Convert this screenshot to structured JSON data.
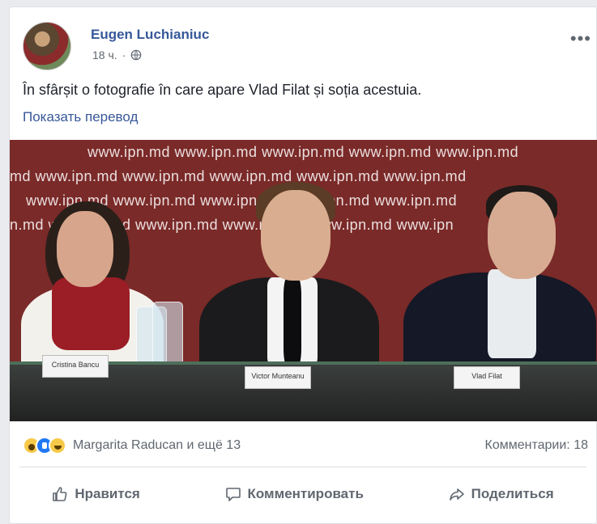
{
  "post": {
    "author": "Eugen Luchianiuc",
    "time": "18 ч.",
    "separator": "·",
    "more": "•••",
    "text": "În sfârșit o fotografie în care apare Vlad Filat și soția acestuia.",
    "translate": "Показать перевод"
  },
  "photo": {
    "backdrop": [
      "www.ipn.md   www.ipn.md   www.ipn.md   www.ipn.md   www.ipn.md",
      "md   www.ipn.md   www.ipn.md   www.ipn.md   www.ipn.md   www.ipn.md",
      "www.ipn.md   www.ipn.md   www.ipn.md   www.ipn.md   www.ipn.md",
      "n.md   www.ipn.md   www.ipn.md   www.ipn.md   www.ipn.md   www.ipn"
    ],
    "nameplates": [
      "Cristina Bancu",
      "Victor Munteanu",
      "Vlad Filat"
    ]
  },
  "reactions": {
    "names": "Margarita Raducan и ещё 13",
    "comments": "Комментарии: 18"
  },
  "actions": {
    "like": "Нравится",
    "comment": "Комментировать",
    "share": "Поделиться"
  }
}
